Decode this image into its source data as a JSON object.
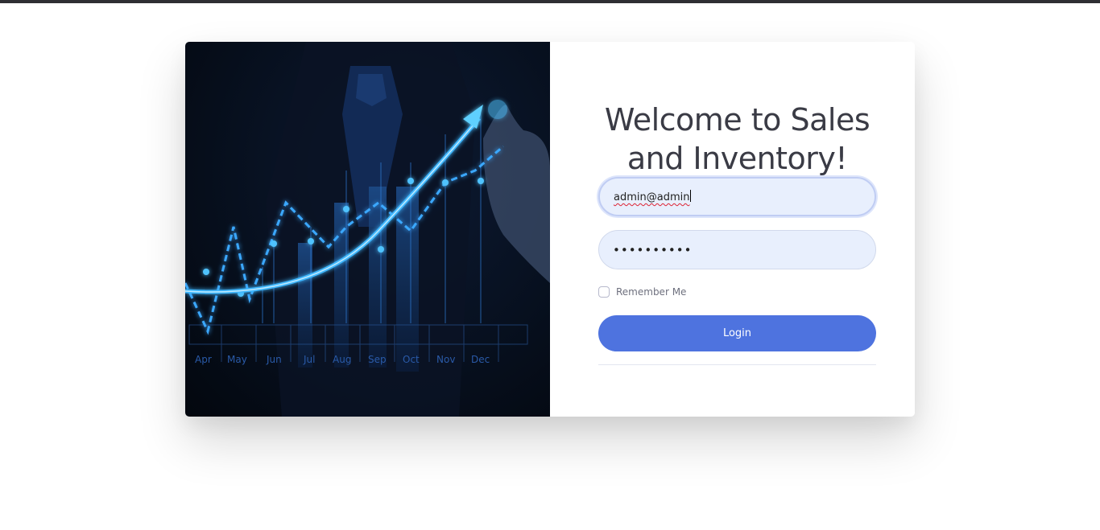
{
  "login": {
    "title": "Welcome to Sales and Inventory!",
    "email_value": "admin@admin",
    "password_dots": "••••••••••",
    "remember_label": "Remember Me",
    "login_label": "Login"
  },
  "hero": {
    "month_labels": [
      "Apr",
      "May",
      "Jun",
      "Jul",
      "Aug",
      "Sep",
      "Oct",
      "Nov",
      "Dec"
    ]
  },
  "colors": {
    "primary": "#4e73df",
    "input_bg": "#e8effd",
    "title_text": "#3a3b45",
    "chart_glow": "#29a8ff"
  }
}
